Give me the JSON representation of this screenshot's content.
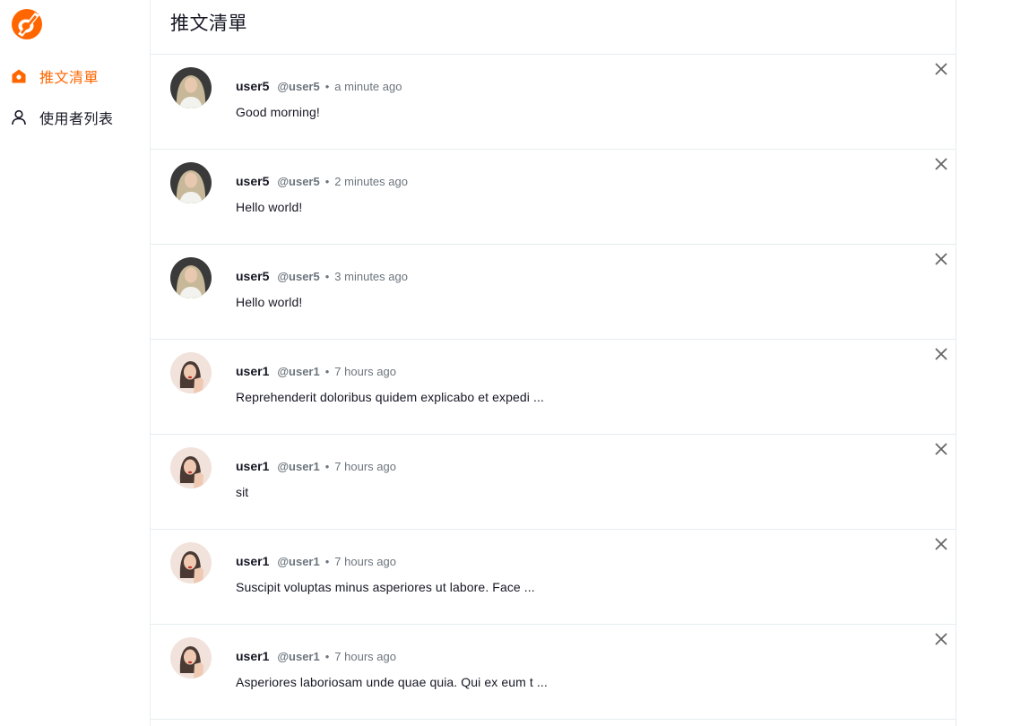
{
  "app": {
    "logo": "alphacamp-logo-icon",
    "brand_color": "#ff6600"
  },
  "sidebar": {
    "items": [
      {
        "label": "推文清單",
        "icon": "home-icon",
        "active": true
      },
      {
        "label": "使用者列表",
        "icon": "user-icon",
        "active": false
      }
    ]
  },
  "header": {
    "title": "推文清單"
  },
  "tweets": [
    {
      "name": "user5",
      "account": "@user5",
      "dot": "•",
      "time": "a minute ago",
      "text": "Good morning!",
      "avatar": "avatar-user5"
    },
    {
      "name": "user5",
      "account": "@user5",
      "dot": "•",
      "time": "2 minutes ago",
      "text": "Hello world!",
      "avatar": "avatar-user5"
    },
    {
      "name": "user5",
      "account": "@user5",
      "dot": "•",
      "time": "3 minutes ago",
      "text": "Hello world!",
      "avatar": "avatar-user5"
    },
    {
      "name": "user1",
      "account": "@user1",
      "dot": "•",
      "time": "7 hours ago",
      "text": "Reprehenderit doloribus quidem explicabo et expedi ...",
      "avatar": "avatar-user1"
    },
    {
      "name": "user1",
      "account": "@user1",
      "dot": "•",
      "time": "7 hours ago",
      "text": "sit",
      "avatar": "avatar-user1"
    },
    {
      "name": "user1",
      "account": "@user1",
      "dot": "•",
      "time": "7 hours ago",
      "text": "Suscipit voluptas minus asperiores ut labore. Face ...",
      "avatar": "avatar-user1"
    },
    {
      "name": "user1",
      "account": "@user1",
      "dot": "•",
      "time": "7 hours ago",
      "text": "Asperiores laboriosam unde quae quia. Qui ex eum t ...",
      "avatar": "avatar-user1"
    }
  ]
}
